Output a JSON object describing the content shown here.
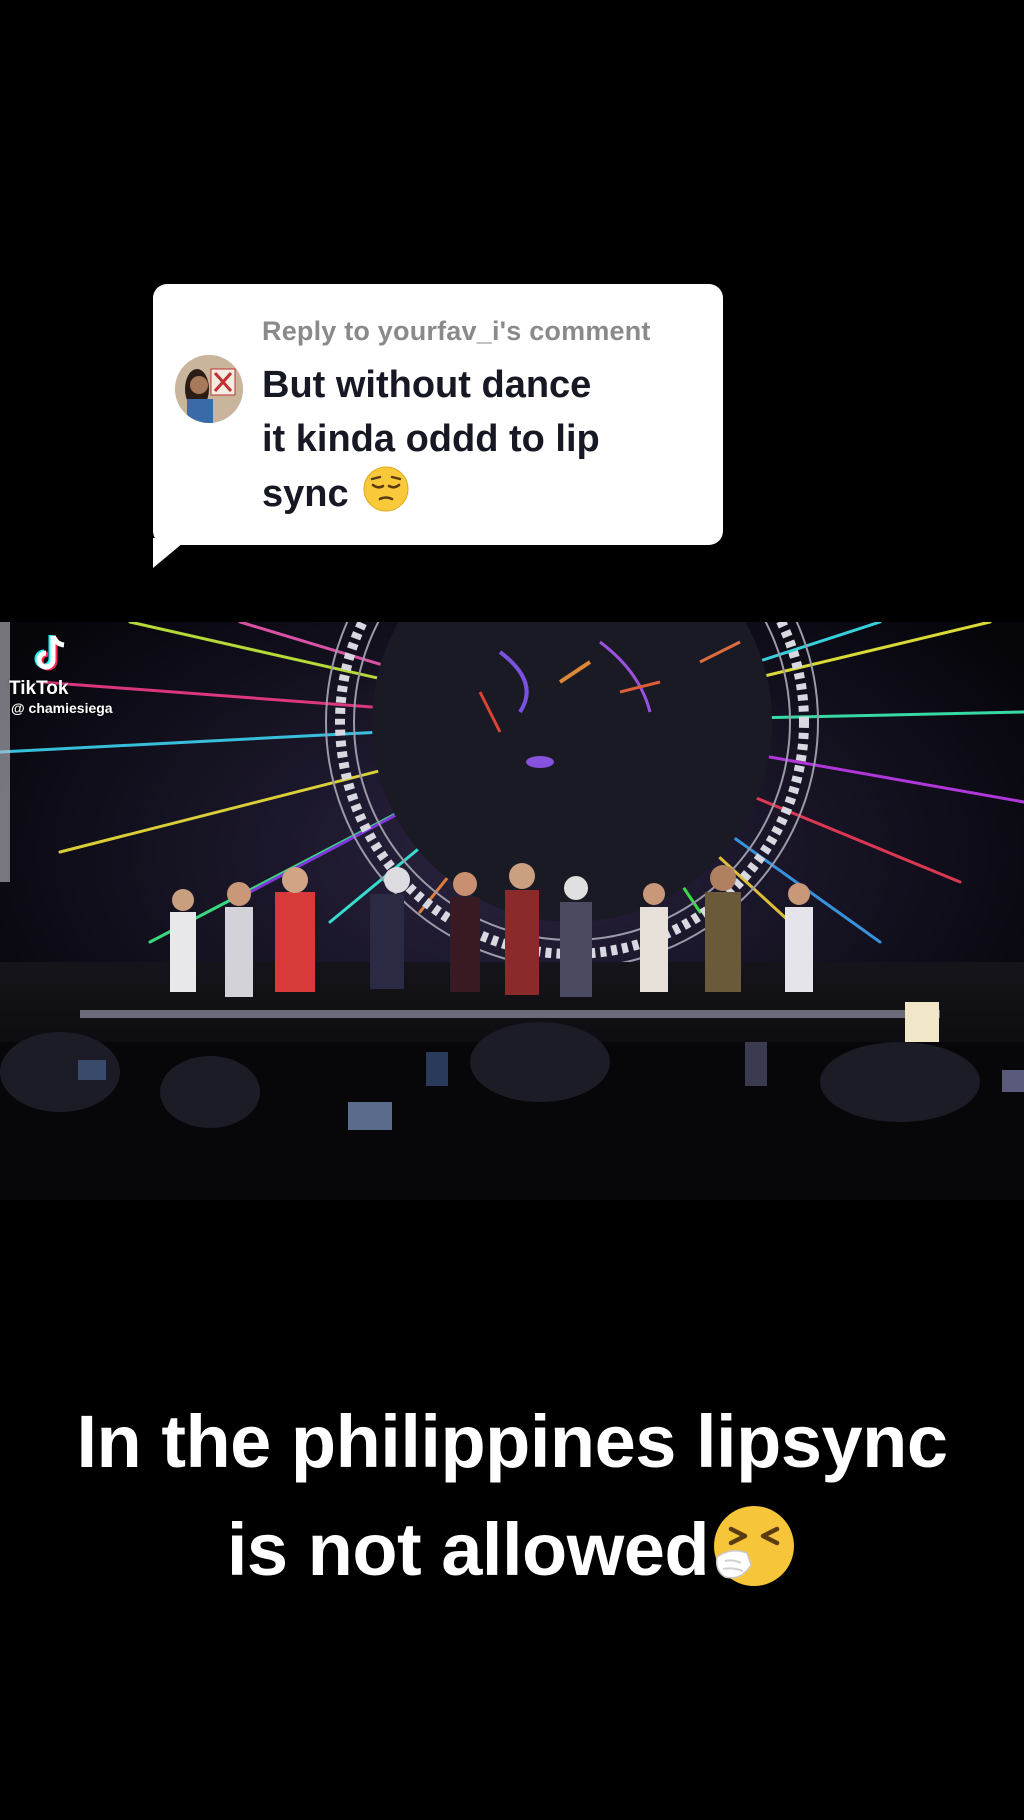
{
  "reply": {
    "header": "Reply to yourfav_i's comment",
    "line1": "But without dance",
    "line2": "it kinda oddd to lip",
    "line3": "sync",
    "emoji": "pensive-face-icon"
  },
  "watermark": {
    "brand": "TikTok",
    "handle": "@ chamiesiega"
  },
  "caption": {
    "line1": "In the philippines lipsync",
    "line2": "is not allowed",
    "emoji": "sneezing-face-icon"
  },
  "colors": {
    "background": "#000000",
    "bubble": "#ffffff",
    "reply_header": "#8a8a8a",
    "reply_text": "#161823",
    "caption_text": "#ffffff"
  }
}
